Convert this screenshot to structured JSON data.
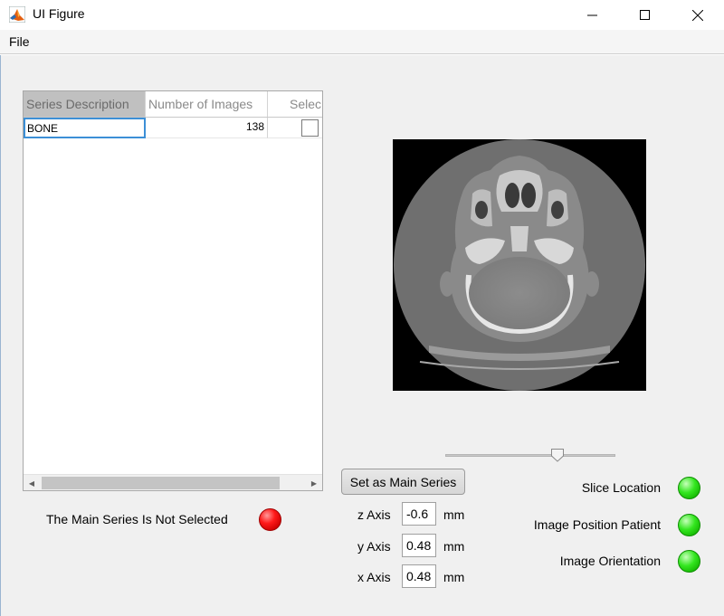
{
  "window": {
    "title": "UI Figure"
  },
  "menubar": {
    "file": "File"
  },
  "series_table": {
    "columns": [
      "Series Description",
      "Number of Images",
      "Selec"
    ],
    "rows": [
      {
        "description": "BONE",
        "num_images": "138",
        "selected": false
      }
    ]
  },
  "main_series": {
    "status_text": "The Main Series Is Not Selected",
    "status_color": "#ff0000",
    "button_label": "Set as Main Series"
  },
  "axes": {
    "z": {
      "label": "z Axis",
      "value": "-0.6",
      "unit": "mm"
    },
    "y": {
      "label": "y Axis",
      "value": "0.48",
      "unit": "mm"
    },
    "x": {
      "label": "x Axis",
      "value": "0.48",
      "unit": "mm"
    }
  },
  "slider": {
    "position_fraction": 0.66
  },
  "checks": [
    {
      "label": "Slice Location",
      "color": "#22dd11"
    },
    {
      "label": "Image Position Patient",
      "color": "#22dd11"
    },
    {
      "label": "Image Orientation",
      "color": "#22dd11"
    }
  ],
  "image": {
    "description_icon": "ct-axial-head-slice"
  }
}
